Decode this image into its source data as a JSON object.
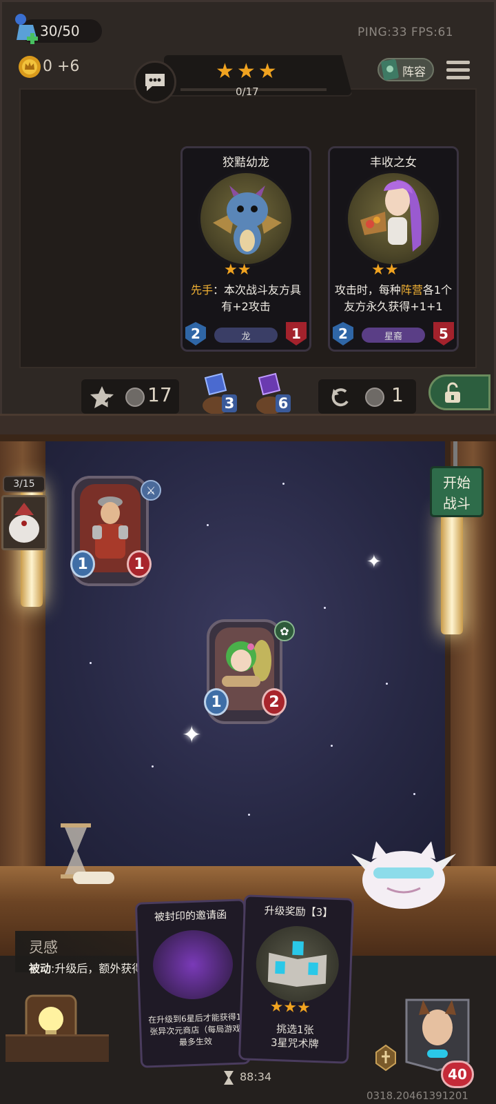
{
  "hud": {
    "health": "30/50",
    "gold": "0 +6",
    "ping_fps": "PING:33   FPS:61",
    "lineup_label": "阵容"
  },
  "tier": {
    "stars": "★★★",
    "progress": "0/17"
  },
  "shop_cards": [
    {
      "name": "狡黠幼龙",
      "stars": "★★",
      "desc_keyword": "先手",
      "desc_rest": "：本次战斗友方具有+2攻击",
      "attack": "2",
      "health": "1",
      "tribe": "龙"
    },
    {
      "name": "丰收之女",
      "stars": "★★",
      "desc_pre": "攻击时，每种",
      "desc_keyword": "阵营",
      "desc_post": "各1个友方永久获得+1+1",
      "attack": "2",
      "health": "5",
      "tribe": "星裔"
    }
  ],
  "shop_bar": {
    "level_up_cost": "17",
    "gem_blue_count": "3",
    "gem_purple_count": "6",
    "refresh_cost": "1"
  },
  "board": {
    "round": "3/15",
    "start_battle": "开始\n战斗",
    "units": [
      {
        "attack": "1",
        "health": "1"
      },
      {
        "attack": "1",
        "health": "2"
      }
    ]
  },
  "hint": {
    "title": "灵感",
    "body_keyword": "被动",
    "body_rest": ":升级后，额外获得1张升级奖励"
  },
  "hand": [
    {
      "title": "被封印的邀请函",
      "desc": "在升级到6星后才能获得1张异次元商店（每局游戏最多生效"
    },
    {
      "title": "升级奖励【3】",
      "stars": "★★★",
      "desc": "挑选1张\n3星咒术牌"
    }
  ],
  "footer": {
    "timer": "88:34",
    "hero_health": "40",
    "build_id": "0318.20461391201"
  },
  "colors": {
    "star_gold": "#f0a320",
    "keyword_gold": "#f2b234",
    "start_button": "#2e6c4a",
    "health_red": "#a8252c",
    "attack_blue": "#3f6ea6"
  }
}
